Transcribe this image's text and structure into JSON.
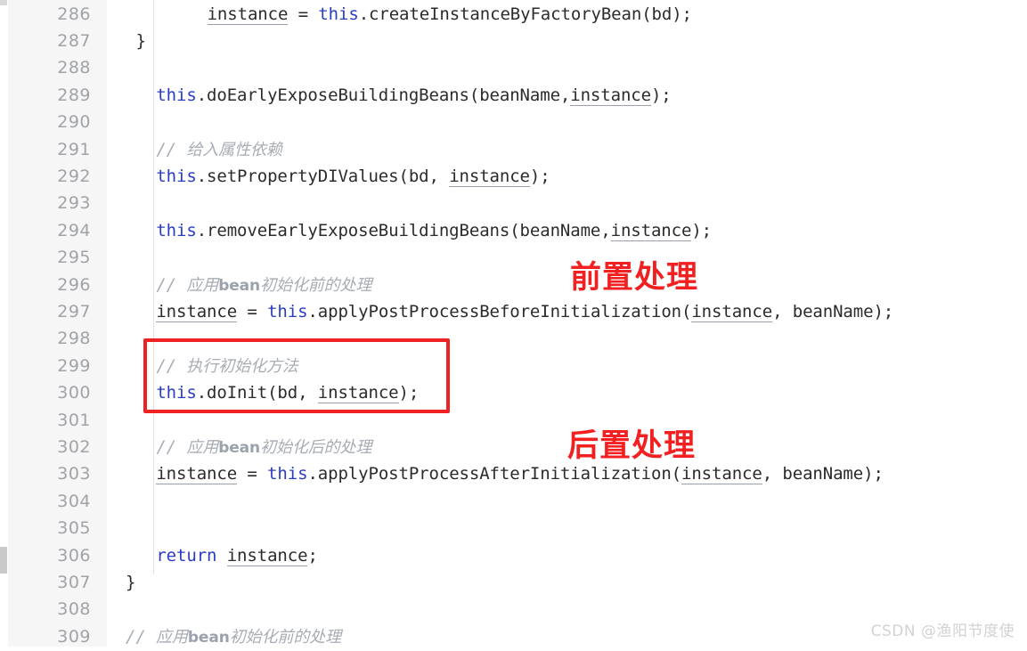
{
  "editor": {
    "language": "java",
    "theme": "light",
    "gutter": {
      "first_line": 286,
      "last_line": 309,
      "line_numbers": [
        286,
        287,
        288,
        289,
        290,
        291,
        292,
        293,
        294,
        295,
        296,
        297,
        298,
        299,
        300,
        301,
        302,
        303,
        304,
        305,
        306,
        307,
        308,
        309
      ],
      "fold_markers": [
        287,
        307
      ]
    },
    "lines": [
      {
        "number": 286,
        "indent": 8,
        "tokens": [
          {
            "t": "instance",
            "k": "var"
          },
          {
            "t": " = ",
            "k": "plain"
          },
          {
            "t": "this",
            "k": "kw"
          },
          {
            "t": ".createInstanceByFactoryBean(bd);",
            "k": "plain"
          }
        ]
      },
      {
        "number": 287,
        "indent": 1,
        "tokens": [
          {
            "t": "}",
            "k": "plain"
          }
        ]
      },
      {
        "number": 288,
        "indent": 0,
        "tokens": []
      },
      {
        "number": 289,
        "indent": 3,
        "tokens": [
          {
            "t": "this",
            "k": "kw"
          },
          {
            "t": ".doEarlyExposeBuildingBeans(beanName,",
            "k": "plain"
          },
          {
            "t": "instance",
            "k": "var"
          },
          {
            "t": ");",
            "k": "plain"
          }
        ]
      },
      {
        "number": 290,
        "indent": 0,
        "tokens": []
      },
      {
        "number": 291,
        "indent": 3,
        "tokens": [
          {
            "t": "// ",
            "k": "cmt"
          },
          {
            "t": "给入属性依赖",
            "k": "cmt-cn"
          }
        ]
      },
      {
        "number": 292,
        "indent": 3,
        "tokens": [
          {
            "t": "this",
            "k": "kw"
          },
          {
            "t": ".setPropertyDIValues(bd, ",
            "k": "plain"
          },
          {
            "t": "instance",
            "k": "var"
          },
          {
            "t": ");",
            "k": "plain"
          }
        ]
      },
      {
        "number": 293,
        "indent": 0,
        "tokens": []
      },
      {
        "number": 294,
        "indent": 3,
        "tokens": [
          {
            "t": "this",
            "k": "kw"
          },
          {
            "t": ".removeEarlyExposeBuildingBeans(beanName,",
            "k": "plain"
          },
          {
            "t": "instance",
            "k": "var"
          },
          {
            "t": ");",
            "k": "plain"
          }
        ]
      },
      {
        "number": 295,
        "indent": 0,
        "tokens": []
      },
      {
        "number": 296,
        "indent": 3,
        "tokens": [
          {
            "t": "// ",
            "k": "cmt"
          },
          {
            "t": "应用",
            "k": "cmt-cn"
          },
          {
            "t": "bean",
            "k": "cmt-b"
          },
          {
            "t": "初始化前的处理",
            "k": "cmt-cn"
          }
        ]
      },
      {
        "number": 297,
        "indent": 3,
        "tokens": [
          {
            "t": "instance",
            "k": "var"
          },
          {
            "t": " = ",
            "k": "plain"
          },
          {
            "t": "this",
            "k": "kw"
          },
          {
            "t": ".applyPostProcessBeforeInitialization(",
            "k": "plain"
          },
          {
            "t": "instance",
            "k": "var"
          },
          {
            "t": ", beanName);",
            "k": "plain"
          }
        ]
      },
      {
        "number": 298,
        "indent": 0,
        "tokens": []
      },
      {
        "number": 299,
        "indent": 3,
        "tokens": [
          {
            "t": "// ",
            "k": "cmt"
          },
          {
            "t": "执行初始化方法",
            "k": "cmt-cn"
          }
        ]
      },
      {
        "number": 300,
        "indent": 3,
        "tokens": [
          {
            "t": "this",
            "k": "kw"
          },
          {
            "t": ".doInit(bd, ",
            "k": "plain"
          },
          {
            "t": "instance",
            "k": "var"
          },
          {
            "t": ");",
            "k": "plain"
          }
        ]
      },
      {
        "number": 301,
        "indent": 0,
        "tokens": []
      },
      {
        "number": 302,
        "indent": 3,
        "tokens": [
          {
            "t": "// ",
            "k": "cmt"
          },
          {
            "t": "应用",
            "k": "cmt-cn"
          },
          {
            "t": "bean",
            "k": "cmt-b"
          },
          {
            "t": "初始化后的处理",
            "k": "cmt-cn"
          }
        ]
      },
      {
        "number": 303,
        "indent": 3,
        "tokens": [
          {
            "t": "instance",
            "k": "var"
          },
          {
            "t": " = ",
            "k": "plain"
          },
          {
            "t": "this",
            "k": "kw"
          },
          {
            "t": ".applyPostProcessAfterInitialization(",
            "k": "plain"
          },
          {
            "t": "instance",
            "k": "var"
          },
          {
            "t": ", beanName);",
            "k": "plain"
          }
        ]
      },
      {
        "number": 304,
        "indent": 0,
        "tokens": []
      },
      {
        "number": 305,
        "indent": 0,
        "tokens": []
      },
      {
        "number": 306,
        "indent": 3,
        "tokens": [
          {
            "t": "return ",
            "k": "kw"
          },
          {
            "t": "instance",
            "k": "var"
          },
          {
            "t": ";",
            "k": "plain"
          }
        ]
      },
      {
        "number": 307,
        "indent": 0,
        "tokens": [
          {
            "t": "}",
            "k": "plain"
          }
        ]
      },
      {
        "number": 308,
        "indent": 0,
        "tokens": []
      },
      {
        "number": 309,
        "indent": 0,
        "tokens": [
          {
            "t": "// ",
            "k": "cmt"
          },
          {
            "t": "应用",
            "k": "cmt-cn"
          },
          {
            "t": "bean",
            "k": "cmt-b"
          },
          {
            "t": "初始化前的处理",
            "k": "cmt-cn"
          }
        ]
      }
    ]
  },
  "annotations": {
    "highlight_box": {
      "covers_lines": "299-300",
      "color": "#ee2222"
    },
    "labels": [
      {
        "id": "annot-pre",
        "text": "前置处理",
        "color": "#f22020"
      },
      {
        "id": "annot-post",
        "text": "后置处理",
        "color": "#f22020"
      }
    ]
  },
  "watermark": {
    "text": "CSDN @渔阳节度使",
    "color": "#d2d2d2"
  },
  "colors": {
    "background": "#ffffff",
    "gutter_background": "#f6f6f6",
    "line_number": "#a0a3a8",
    "keyword": "#2a3cc4",
    "identifier": "#2b2b2b",
    "comment": "#a8adb4",
    "annotation_red": "#f22020"
  }
}
